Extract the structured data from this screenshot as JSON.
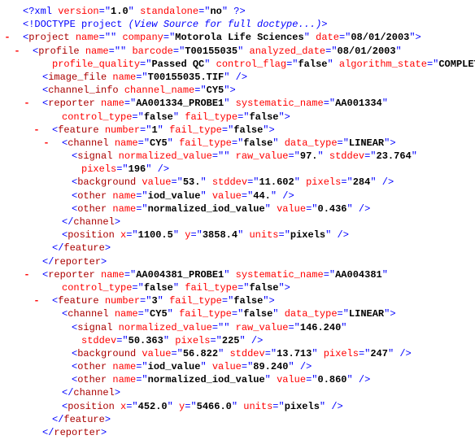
{
  "xml": {
    "pi_open": "<?",
    "pi_name": "xml",
    "version_attr": "version",
    "version_val": "1.0",
    "standalone_attr": "standalone",
    "standalone_val": "no",
    "pi_close": "?>",
    "doctype": "<!DOCTYPE project ",
    "doctype_italic": "(View Source for full doctype...)",
    "doctype_close": ">",
    "project": {
      "tag": "project",
      "name_attr": "name",
      "name_val": "",
      "company_attr": "company",
      "company_val": "Motorola Life Sciences",
      "date_attr": "date",
      "date_val": "08/01/2003",
      "profile": {
        "tag": "profile",
        "name_attr": "name",
        "name_val": "",
        "barcode_attr": "barcode",
        "barcode_val": "T00155035",
        "analyzed_attr": "analyzed_date",
        "analyzed_val": "08/01/2003",
        "quality_attr": "profile_quality",
        "quality_val": "Passed QC",
        "flag_attr": "control_flag",
        "flag_val": "false",
        "alg_attr": "algorithm_state",
        "alg_val": "COMPLETE",
        "image_file": {
          "tag": "image_file",
          "name_attr": "name",
          "name_val": "T00155035.TIF"
        },
        "channel_info": {
          "tag": "channel_info",
          "cn_attr": "channel_name",
          "cn_val": "CY5"
        },
        "reporter1": {
          "tag": "reporter",
          "name_attr": "name",
          "name_val": "AA001334_PROBE1",
          "sys_attr": "systematic_name",
          "sys_val": "AA001334",
          "ctrl_attr": "control_type",
          "ctrl_val": "false",
          "fail_attr": "fail_type",
          "fail_val": "false",
          "feature": {
            "tag": "feature",
            "num_attr": "number",
            "num_val": "1",
            "fail_attr": "fail_type",
            "fail_val": "false",
            "channel": {
              "tag": "channel",
              "name_attr": "name",
              "name_val": "CY5",
              "fail_attr": "fail_type",
              "fail_val": "false",
              "dt_attr": "data_type",
              "dt_val": "LINEAR",
              "signal": {
                "tag": "signal",
                "nv_attr": "normalized_value",
                "nv_val": "",
                "raw_attr": "raw_value",
                "raw_val": "97.",
                "std_attr": "stddev",
                "std_val": "23.764",
                "pix_attr": "pixels",
                "pix_val": "196"
              },
              "background": {
                "tag": "background",
                "val_attr": "value",
                "val_val": "53.",
                "std_attr": "stddev",
                "std_val": "11.602",
                "pix_attr": "pixels",
                "pix_val": "284"
              },
              "other1": {
                "tag": "other",
                "name_attr": "name",
                "name_val": "iod_value",
                "val_attr": "value",
                "val_val": "44."
              },
              "other2": {
                "tag": "other",
                "name_attr": "name",
                "name_val": "normalized_iod_value",
                "val_attr": "value",
                "val_val": "0.436"
              }
            },
            "position": {
              "tag": "position",
              "x_attr": "x",
              "x_val": "1100.5",
              "y_attr": "y",
              "y_val": "3858.4",
              "u_attr": "units",
              "u_val": "pixels"
            }
          }
        },
        "reporter2": {
          "tag": "reporter",
          "name_attr": "name",
          "name_val": "AA004381_PROBE1",
          "sys_attr": "systematic_name",
          "sys_val": "AA004381",
          "ctrl_attr": "control_type",
          "ctrl_val": "false",
          "fail_attr": "fail_type",
          "fail_val": "false",
          "feature": {
            "tag": "feature",
            "num_attr": "number",
            "num_val": "3",
            "fail_attr": "fail_type",
            "fail_val": "false",
            "channel": {
              "tag": "channel",
              "name_attr": "name",
              "name_val": "CY5",
              "fail_attr": "fail_type",
              "fail_val": "false",
              "dt_attr": "data_type",
              "dt_val": "LINEAR",
              "signal": {
                "tag": "signal",
                "nv_attr": "normalized_value",
                "nv_val": "",
                "raw_attr": "raw_value",
                "raw_val": "146.240",
                "std_attr": "stddev",
                "std_val": "50.363",
                "pix_attr": "pixels",
                "pix_val": "225"
              },
              "background": {
                "tag": "background",
                "val_attr": "value",
                "val_val": "56.822",
                "std_attr": "stddev",
                "std_val": "13.713",
                "pix_attr": "pixels",
                "pix_val": "247"
              },
              "other1": {
                "tag": "other",
                "name_attr": "name",
                "name_val": "iod_value",
                "val_attr": "value",
                "val_val": "89.240"
              },
              "other2": {
                "tag": "other",
                "name_attr": "name",
                "name_val": "normalized_iod_value",
                "val_attr": "value",
                "val_val": "0.860"
              }
            },
            "position": {
              "tag": "position",
              "x_attr": "x",
              "x_val": "452.0",
              "y_attr": "y",
              "y_val": "5466.0",
              "u_attr": "units",
              "u_val": "pixels"
            }
          }
        }
      }
    }
  }
}
